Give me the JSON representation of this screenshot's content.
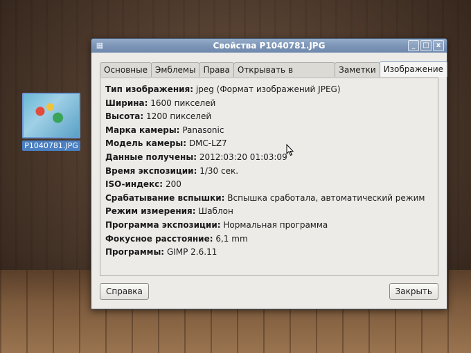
{
  "desktop": {
    "file_icon_label": "P1040781.JPG"
  },
  "dialog": {
    "title": "Свойства P1040781.JPG",
    "window_controls": [
      "_",
      "□",
      "x"
    ],
    "tabs": [
      {
        "label": "Основные",
        "active": false
      },
      {
        "label": "Эмблемы",
        "active": false
      },
      {
        "label": "Права",
        "active": false
      },
      {
        "label": "Открывать в программе",
        "active": false
      },
      {
        "label": "Заметки",
        "active": false
      },
      {
        "label": "Изображение",
        "active": true
      }
    ],
    "properties": [
      {
        "key": "Тип изображения:",
        "value": "jpeg (Формат изображений JPEG)"
      },
      {
        "key": "Ширина:",
        "value": "1600 пикселей"
      },
      {
        "key": "Высота:",
        "value": "1200 пикселей"
      },
      {
        "key": "Марка камеры:",
        "value": "Panasonic"
      },
      {
        "key": "Модель камеры:",
        "value": "DMC-LZ7"
      },
      {
        "key": "Данные получены:",
        "value": "2012:03:20 01:03:09"
      },
      {
        "key": "Время экспозиции:",
        "value": "1/30 сек."
      },
      {
        "key": "ISO-индекс:",
        "value": "200"
      },
      {
        "key": "Срабатывание вспышки:",
        "value": "Вспышка сработала, автоматический режим"
      },
      {
        "key": "Режим измерения:",
        "value": "Шаблон"
      },
      {
        "key": "Программа экспозиции:",
        "value": "Нормальная программа"
      },
      {
        "key": "Фокусное расстояние:",
        "value": "6,1 mm"
      },
      {
        "key": "Программы:",
        "value": "GIMP 2.6.11"
      }
    ],
    "help_button": "Справка",
    "close_button": "Закрыть"
  },
  "colors": {
    "titlebar": "#7d96b8",
    "dialog_bg": "#ecebe8",
    "selection": "#4a7fc1"
  }
}
